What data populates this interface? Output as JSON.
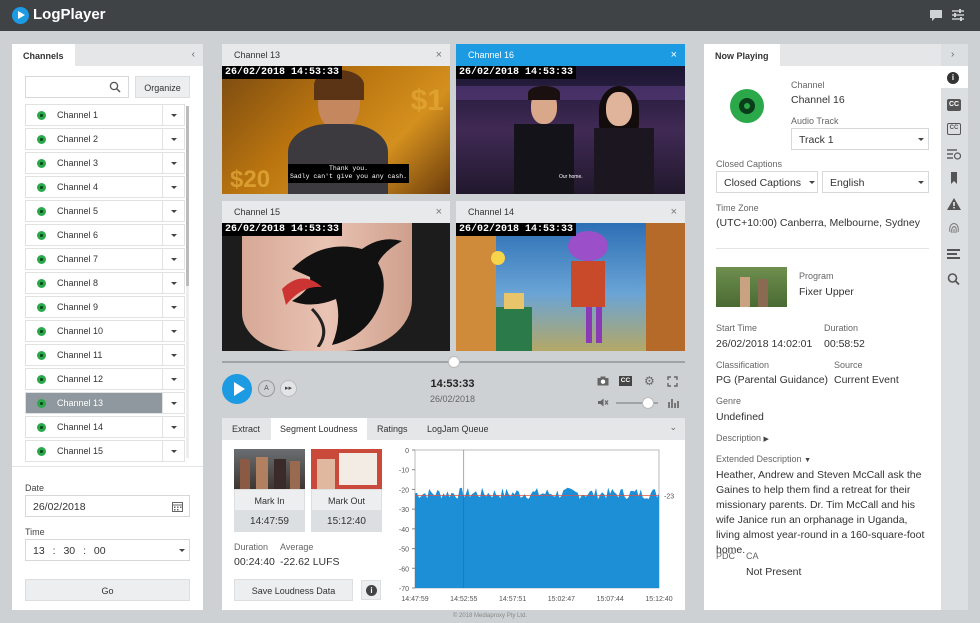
{
  "app": {
    "title": "LogPlayer"
  },
  "channels_panel": {
    "tab": "Channels",
    "search_placeholder": "",
    "organize": "Organize",
    "items": [
      "Channel 1",
      "Channel 2",
      "Channel 3",
      "Channel 4",
      "Channel 5",
      "Channel 6",
      "Channel 7",
      "Channel 8",
      "Channel 9",
      "Channel 10",
      "Channel 11",
      "Channel 12",
      "Channel 13",
      "Channel 14",
      "Channel 15"
    ],
    "selected": "Channel 13",
    "date_label": "Date",
    "date_value": "26/02/2018",
    "time_label": "Time",
    "time_h": "13",
    "time_m": "30",
    "time_s": "00",
    "go": "Go"
  },
  "videos": [
    {
      "title": "Channel 13",
      "stamp": "26/02/2018 14:53:33",
      "caption1": "Thank you.",
      "caption2": "Sadly can't give you any cash."
    },
    {
      "title": "Channel 16",
      "stamp": "26/02/2018 14:53:33",
      "caption": "Our home."
    },
    {
      "title": "Channel 15",
      "stamp": "26/02/2018 14:53:33"
    },
    {
      "title": "Channel 14",
      "stamp": "26/02/2018 14:53:33"
    }
  ],
  "player": {
    "time": "14:53:33",
    "date": "26/02/2018",
    "seek_fraction": 0.5,
    "volume_fraction": 0.75,
    "cc": "CC"
  },
  "bottom_tabs": [
    "Extract",
    "Segment Loudness",
    "Ratings",
    "LogJam Queue"
  ],
  "loudness": {
    "mark_in": "Mark In",
    "mark_in_time": "14:47:59",
    "mark_out": "Mark Out",
    "mark_out_time": "15:12:40",
    "duration_label": "Duration",
    "duration": "00:24:40",
    "average_label": "Average",
    "average": "-22.62 LUFS",
    "save": "Save Loudness Data",
    "info": "i",
    "ref_label": "-23"
  },
  "chart_data": {
    "type": "area",
    "x_ticks": [
      "14:47:59",
      "14:52:55",
      "14:57:51",
      "15:02:47",
      "15:07:44",
      "15:12:40"
    ],
    "y_ticks": [
      0,
      -10,
      -20,
      -30,
      -40,
      -50,
      -60,
      -70
    ],
    "ylim": [
      -70,
      0
    ],
    "reference_line": -23,
    "approx_level": -22,
    "color": "#1c8fd6"
  },
  "now_playing": {
    "tab": "Now Playing",
    "channel_label": "Channel",
    "channel": "Channel 16",
    "audio_label": "Audio Track",
    "audio": "Track 1",
    "cc_label": "Closed Captions",
    "cc": "Closed Captions",
    "lang": "English",
    "tz_label": "Time Zone",
    "tz": "(UTC+10:00) Canberra, Melbourne, Sydney",
    "program_label": "Program",
    "program": "Fixer Upper",
    "start_label": "Start Time",
    "start": "26/02/2018 14:02:01",
    "duration_label": "Duration",
    "duration": "00:58:52",
    "class_label": "Classification",
    "class": "PG (Parental Guidance)",
    "source_label": "Source",
    "source": "Current Event",
    "genre_label": "Genre",
    "genre": "Undefined",
    "desc_label": "Description",
    "ext_label": "Extended Description",
    "ext": "Heather, Andrew and Steven McCall ask the Gaines to help them find a retreat for their missionary parents. Dr. Tim McCall and his wife Janice run an orphanage in Uganda, living almost year-round in a 160-square-foot home.",
    "pdc": "PDC",
    "ca": "CA",
    "ca_value": "Not Present"
  },
  "footer": "© 2018 Mediaproxy Pty Ltd."
}
